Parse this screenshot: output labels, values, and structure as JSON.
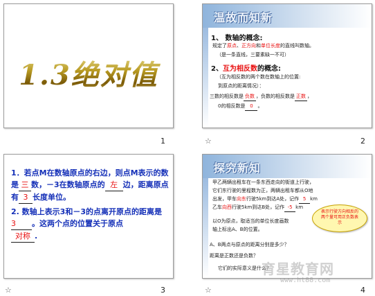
{
  "slides": [
    {
      "number": "1",
      "title": "1.3绝对值"
    },
    {
      "number": "2",
      "header": "温故而知新",
      "item1_title": "1、 数轴的概念:",
      "item1_line": [
        "规定了",
        "原点",
        "、",
        "正方向",
        "和",
        "单位长度",
        "的直线叫数轴。"
      ],
      "item1_note": "（是一条直线，三要素缺一不可）",
      "item2_prefix": "2、",
      "item2_red": "互为相反数",
      "item2_suffix": "的概念:",
      "item2_note1": "（互为相反数的两个数在数轴上的位置:",
      "item2_note2": "到原点的距离情况）：",
      "item2_line3_a": "三数的相反数是",
      "item2_line3_blank1": "负数",
      "item2_line3_b": "，负数的相反数是",
      "item2_line3_blank2": "正数",
      "item2_line3_c": "，",
      "item2_line4_a": "0的相反数是",
      "item2_line4_blank": "0",
      "item2_line4_b": "。"
    },
    {
      "number": "3",
      "p1_a": "1．若点M在数轴原点的右边，则点M表示的数是",
      "p1_blank1": "三",
      "p1_b": "数，－3在数轴原点的",
      "p1_blank2": "左",
      "p1_c": "边，距离原点有",
      "p1_blank3": "3",
      "p1_d": "长度单位。",
      "p2_a": "2. 数轴上表示3和－3的点离开原点的距离是",
      "p2_blank1": "3",
      "p2_b": "。这两个点的位置关于原点",
      "p2_blank2": "对称",
      "p2_c": "."
    },
    {
      "number": "4",
      "header": "探究新知",
      "line1": "甲乙两辆出租车在一条东西走向的街道上行驶，",
      "line2": "它们东行驶的里程数为正，两辆出租车都从O地",
      "line3_a": "出发，甲车",
      "line3_red": "向东",
      "line3_b": "行驶5km到达A处，记作",
      "line3_blank": "5",
      "line3_c": "km",
      "line4_a": "乙车",
      "line4_red": "向西",
      "line4_b": "行驶5km到达B处，记作",
      "line4_blank": "-5",
      "line4_c": "km",
      "line5": "以O为原点，取适当的单位长度画数",
      "line6": "轴上标出A、B的位置。",
      "bubble": "表示行驶方向相反的两个量可用正负数表示",
      "q1": "A、B两点与原点的距离分别是多少？",
      "q2": "距离是正数还是负数？",
      "q3": "它们的实际意义是什么？"
    }
  ],
  "watermark": {
    "main": "育星教育网",
    "sub": "www.ht88.com"
  }
}
